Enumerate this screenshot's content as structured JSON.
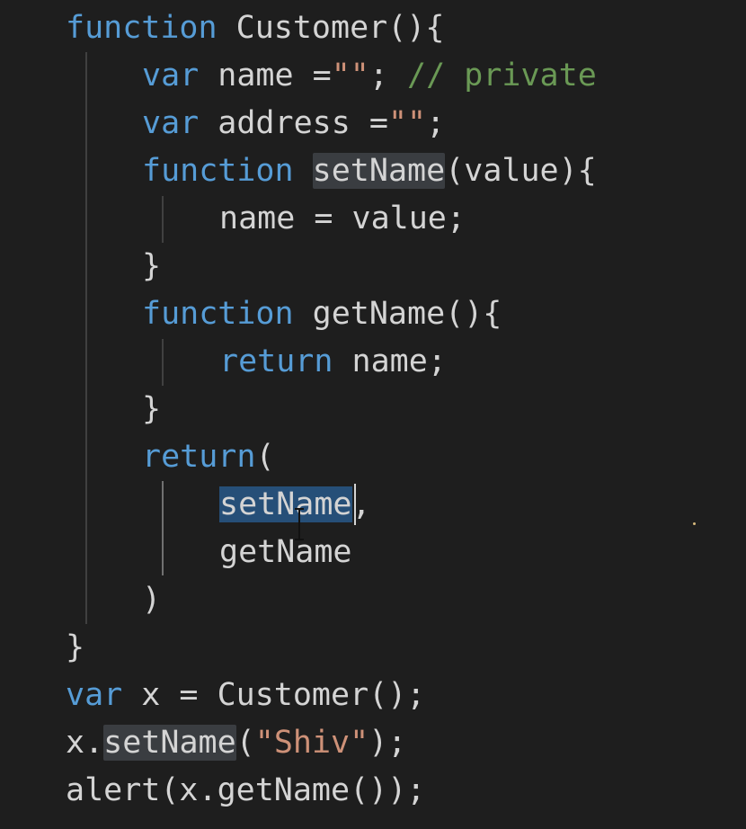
{
  "editor": {
    "lines": [
      {
        "indent": 1,
        "tokens": [
          {
            "t": "function",
            "c": "kw"
          },
          {
            "t": " Customer(){",
            "c": "plain"
          }
        ]
      },
      {
        "indent": 2,
        "tokens": [
          {
            "t": "var",
            "c": "kw"
          },
          {
            "t": " name =",
            "c": "plain"
          },
          {
            "t": "\"\"",
            "c": "str"
          },
          {
            "t": "; ",
            "c": "plain"
          },
          {
            "t": "// private",
            "c": "cmt"
          }
        ]
      },
      {
        "indent": 2,
        "tokens": [
          {
            "t": "var",
            "c": "kw"
          },
          {
            "t": " address =",
            "c": "plain"
          },
          {
            "t": "\"\"",
            "c": "str"
          },
          {
            "t": ";",
            "c": "plain"
          }
        ]
      },
      {
        "indent": 2,
        "tokens": [
          {
            "t": "function",
            "c": "kw"
          },
          {
            "t": " ",
            "c": "plain"
          },
          {
            "t": "setName",
            "c": "plain",
            "hl": "occ"
          },
          {
            "t": "(value){",
            "c": "plain"
          }
        ]
      },
      {
        "indent": 3,
        "tokens": [
          {
            "t": "name = value;",
            "c": "plain"
          }
        ]
      },
      {
        "indent": 2,
        "tokens": [
          {
            "t": "}",
            "c": "plain"
          }
        ]
      },
      {
        "indent": 2,
        "tokens": [
          {
            "t": "function",
            "c": "kw"
          },
          {
            "t": " getName(){",
            "c": "plain"
          }
        ]
      },
      {
        "indent": 3,
        "tokens": [
          {
            "t": "return",
            "c": "kw"
          },
          {
            "t": " name;",
            "c": "plain"
          }
        ]
      },
      {
        "indent": 2,
        "tokens": [
          {
            "t": "}",
            "c": "plain"
          }
        ]
      },
      {
        "indent": 2,
        "tokens": [
          {
            "t": "return",
            "c": "kw"
          },
          {
            "t": "(",
            "c": "plain"
          }
        ]
      },
      {
        "indent": 3,
        "tokens": [
          {
            "t": "setName",
            "c": "plain",
            "hl": "sel"
          },
          {
            "t": ",",
            "c": "plain"
          }
        ]
      },
      {
        "indent": 3,
        "tokens": [
          {
            "t": "getName",
            "c": "plain"
          }
        ]
      },
      {
        "indent": 2,
        "tokens": [
          {
            "t": ")",
            "c": "plain"
          }
        ]
      },
      {
        "indent": 1,
        "tokens": [
          {
            "t": "}",
            "c": "plain"
          }
        ]
      },
      {
        "indent": 1,
        "tokens": [
          {
            "t": "var",
            "c": "kw"
          },
          {
            "t": " x = Customer();",
            "c": "plain"
          }
        ]
      },
      {
        "indent": 1,
        "tokens": [
          {
            "t": "x.",
            "c": "plain"
          },
          {
            "t": "setName",
            "c": "plain",
            "hl": "occ"
          },
          {
            "t": "(",
            "c": "plain"
          },
          {
            "t": "\"Shiv\"",
            "c": "str"
          },
          {
            "t": ");",
            "c": "plain"
          }
        ]
      },
      {
        "indent": 1,
        "tokens": [
          {
            "t": "alert(x.getName());",
            "c": "plain"
          }
        ]
      }
    ]
  },
  "colors": {
    "background": "#1e1e1e",
    "keyword": "#569cd6",
    "string": "#ce9178",
    "comment": "#6a9955",
    "text": "#d4d4d4",
    "selection": "#264f78",
    "occurrence_highlight": "#3a3d41"
  }
}
